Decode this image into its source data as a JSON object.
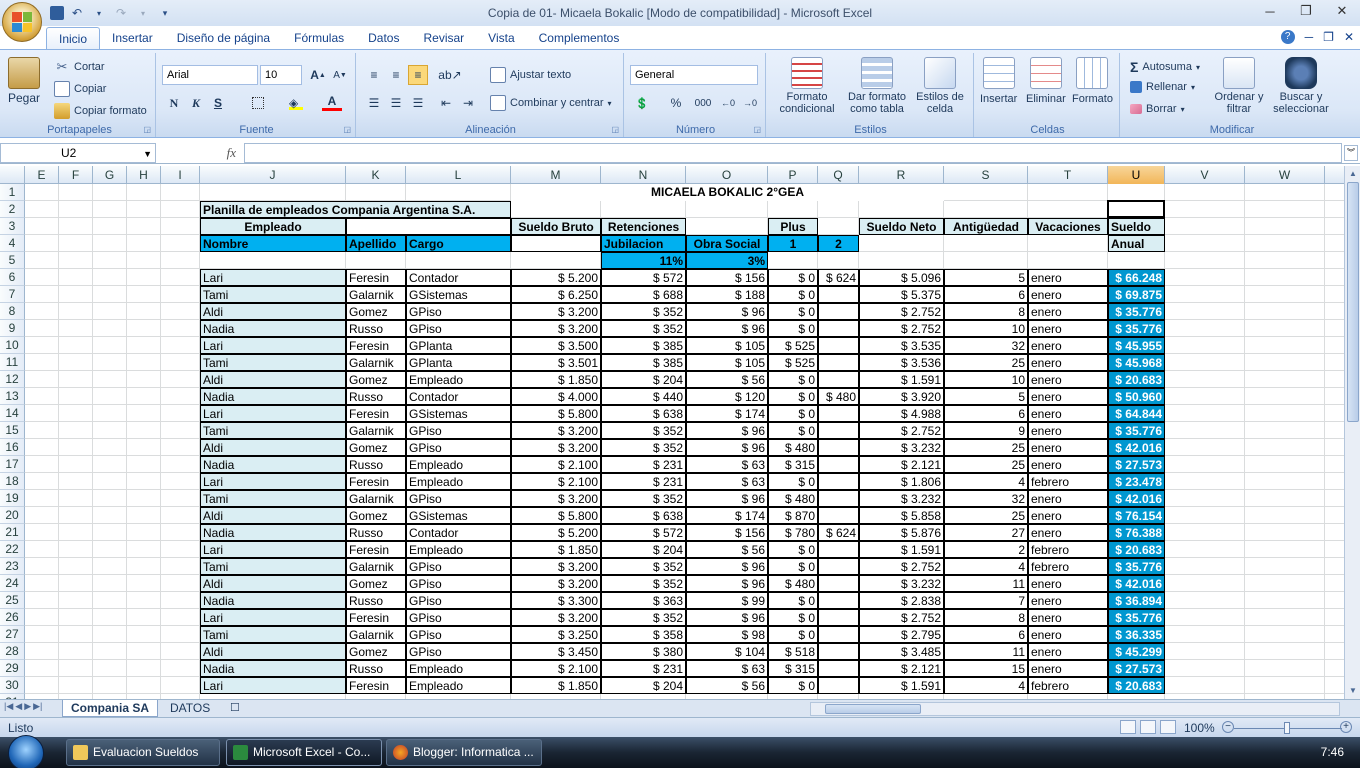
{
  "window": {
    "title": "Copia de 01- Micaela Bokalic  [Modo de compatibilidad] - Microsoft Excel",
    "minimize": "─",
    "maximize": "❐",
    "close": "✕"
  },
  "qat": {
    "save": "💾",
    "undo": "↶",
    "redo": "↷",
    "customize": "▾"
  },
  "ribbon_tabs": [
    "Inicio",
    "Insertar",
    "Diseño de página",
    "Fórmulas",
    "Datos",
    "Revisar",
    "Vista",
    "Complementos"
  ],
  "ribbon": {
    "portapapeles": {
      "pegar": "Pegar",
      "cortar": "Cortar",
      "copiar": "Copiar",
      "copiar_formato": "Copiar formato",
      "label": "Portapapeles"
    },
    "fuente": {
      "font": "Arial",
      "size": "10",
      "bold": "N",
      "italic": "K",
      "underline": "S",
      "font_color": "A",
      "label": "Fuente"
    },
    "alineacion": {
      "ajustar": "Ajustar texto",
      "combinar": "Combinar y centrar",
      "label": "Alineación"
    },
    "numero": {
      "format": "General",
      "percent": "%",
      "thousands": "000",
      "label": "Número"
    },
    "estilos": {
      "formato_condicional": "Formato condicional",
      "dar_formato": "Dar formato como tabla",
      "estilos_celda": "Estilos de celda",
      "label": "Estilos"
    },
    "celdas": {
      "insertar": "Insertar",
      "eliminar": "Eliminar",
      "formato": "Formato",
      "label": "Celdas"
    },
    "modificar": {
      "autosuma": "Autosuma",
      "rellenar": "Rellenar",
      "borrar": "Borrar",
      "ordenar": "Ordenar y filtrar",
      "buscar": "Buscar y seleccionar",
      "label": "Modificar"
    }
  },
  "formula_bar": {
    "name_box": "U2",
    "fx": "fx",
    "value": ""
  },
  "columns": [
    "E",
    "F",
    "G",
    "H",
    "I",
    "J",
    "K",
    "L",
    "M",
    "N",
    "O",
    "P",
    "Q",
    "R",
    "S",
    "T",
    "U",
    "V",
    "W"
  ],
  "selected_column": "U",
  "row_numbers": [
    "1",
    "2",
    "3",
    "4",
    "5",
    "6",
    "7",
    "8",
    "9",
    "10",
    "11",
    "12",
    "13",
    "14",
    "15",
    "16",
    "17",
    "18",
    "19",
    "20",
    "21",
    "22",
    "23",
    "24",
    "25",
    "26",
    "27",
    "28",
    "29",
    "30",
    "31"
  ],
  "sheet": {
    "banner": "MICAELA BOKALIC 2°GEA",
    "title": "Planilla de empleados Compania Argentina S.A.",
    "h_empleado": "Empleado",
    "h_sueldo_bruto": "Sueldo Bruto",
    "h_retenciones": "Retenciones",
    "h_plus": "Plus",
    "h_sueldo_neto": "Sueldo Neto",
    "h_antiguedad": "Antigüedad",
    "h_vacaciones": "Vacaciones",
    "h_sueldo": "Sueldo",
    "h_nombre": "Nombre",
    "h_apellido": "Apellido",
    "h_cargo": "Cargo",
    "h_jubilacion": "Jubilacion",
    "h_obra_social": "Obra Social",
    "h_plus1": "1",
    "h_plus2": "2",
    "h_anual": "Anual",
    "pct_jub": "11%",
    "pct_os": "3%",
    "rows": [
      [
        "Lari",
        "Feresin",
        "Contador",
        "$ 5.200",
        "$ 572",
        "$ 156",
        "$ 0",
        "$ 624",
        "$ 5.096",
        "5",
        "enero",
        "$ 66.248"
      ],
      [
        "Tami",
        "Galarnik",
        "GSistemas",
        "$ 6.250",
        "$ 688",
        "$ 188",
        "$ 0",
        "",
        "$ 5.375",
        "6",
        "enero",
        "$ 69.875"
      ],
      [
        "Aldi",
        "Gomez",
        "GPiso",
        "$ 3.200",
        "$ 352",
        "$ 96",
        "$ 0",
        "",
        "$ 2.752",
        "8",
        "enero",
        "$ 35.776"
      ],
      [
        "Nadia",
        "Russo",
        "GPiso",
        "$ 3.200",
        "$ 352",
        "$ 96",
        "$ 0",
        "",
        "$ 2.752",
        "10",
        "enero",
        "$ 35.776"
      ],
      [
        "Lari",
        "Feresin",
        "GPlanta",
        "$ 3.500",
        "$ 385",
        "$ 105",
        "$ 525",
        "",
        "$ 3.535",
        "32",
        "enero",
        "$ 45.955"
      ],
      [
        "Tami",
        "Galarnik",
        "GPlanta",
        "$ 3.501",
        "$ 385",
        "$ 105",
        "$ 525",
        "",
        "$ 3.536",
        "25",
        "enero",
        "$ 45.968"
      ],
      [
        "Aldi",
        "Gomez",
        "Empleado",
        "$ 1.850",
        "$ 204",
        "$ 56",
        "$ 0",
        "",
        "$ 1.591",
        "10",
        "enero",
        "$ 20.683"
      ],
      [
        "Nadia",
        "Russo",
        "Contador",
        "$ 4.000",
        "$ 440",
        "$ 120",
        "$ 0",
        "$ 480",
        "$ 3.920",
        "5",
        "enero",
        "$ 50.960"
      ],
      [
        "Lari",
        "Feresin",
        "GSistemas",
        "$ 5.800",
        "$ 638",
        "$ 174",
        "$ 0",
        "",
        "$ 4.988",
        "6",
        "enero",
        "$ 64.844"
      ],
      [
        "Tami",
        "Galarnik",
        "GPiso",
        "$ 3.200",
        "$ 352",
        "$ 96",
        "$ 0",
        "",
        "$ 2.752",
        "9",
        "enero",
        "$ 35.776"
      ],
      [
        "Aldi",
        "Gomez",
        "GPiso",
        "$ 3.200",
        "$ 352",
        "$ 96",
        "$ 480",
        "",
        "$ 3.232",
        "25",
        "enero",
        "$ 42.016"
      ],
      [
        "Nadia",
        "Russo",
        "Empleado",
        "$ 2.100",
        "$ 231",
        "$ 63",
        "$ 315",
        "",
        "$ 2.121",
        "25",
        "enero",
        "$ 27.573"
      ],
      [
        "Lari",
        "Feresin",
        "Empleado",
        "$ 2.100",
        "$ 231",
        "$ 63",
        "$ 0",
        "",
        "$ 1.806",
        "4",
        "febrero",
        "$ 23.478"
      ],
      [
        "Tami",
        "Galarnik",
        "GPiso",
        "$ 3.200",
        "$ 352",
        "$ 96",
        "$ 480",
        "",
        "$ 3.232",
        "32",
        "enero",
        "$ 42.016"
      ],
      [
        "Aldi",
        "Gomez",
        "GSistemas",
        "$ 5.800",
        "$ 638",
        "$ 174",
        "$ 870",
        "",
        "$ 5.858",
        "25",
        "enero",
        "$ 76.154"
      ],
      [
        "Nadia",
        "Russo",
        "Contador",
        "$ 5.200",
        "$ 572",
        "$ 156",
        "$ 780",
        "$ 624",
        "$ 5.876",
        "27",
        "enero",
        "$ 76.388"
      ],
      [
        "Lari",
        "Feresin",
        "Empleado",
        "$ 1.850",
        "$ 204",
        "$ 56",
        "$ 0",
        "",
        "$ 1.591",
        "2",
        "febrero",
        "$ 20.683"
      ],
      [
        "Tami",
        "Galarnik",
        "GPiso",
        "$ 3.200",
        "$ 352",
        "$ 96",
        "$ 0",
        "",
        "$ 2.752",
        "4",
        "febrero",
        "$ 35.776"
      ],
      [
        "Aldi",
        "Gomez",
        "GPiso",
        "$ 3.200",
        "$ 352",
        "$ 96",
        "$ 480",
        "",
        "$ 3.232",
        "11",
        "enero",
        "$ 42.016"
      ],
      [
        "Nadia",
        "Russo",
        "GPiso",
        "$ 3.300",
        "$ 363",
        "$ 99",
        "$ 0",
        "",
        "$ 2.838",
        "7",
        "enero",
        "$ 36.894"
      ],
      [
        "Lari",
        "Feresin",
        "GPiso",
        "$ 3.200",
        "$ 352",
        "$ 96",
        "$ 0",
        "",
        "$ 2.752",
        "8",
        "enero",
        "$ 35.776"
      ],
      [
        "Tami",
        "Galarnik",
        "GPiso",
        "$ 3.250",
        "$ 358",
        "$ 98",
        "$ 0",
        "",
        "$ 2.795",
        "6",
        "enero",
        "$ 36.335"
      ],
      [
        "Aldi",
        "Gomez",
        "GPiso",
        "$ 3.450",
        "$ 380",
        "$ 104",
        "$ 518",
        "",
        "$ 3.485",
        "11",
        "enero",
        "$ 45.299"
      ],
      [
        "Nadia",
        "Russo",
        "Empleado",
        "$ 2.100",
        "$ 231",
        "$ 63",
        "$ 315",
        "",
        "$ 2.121",
        "15",
        "enero",
        "$ 27.573"
      ],
      [
        "Lari",
        "Feresin",
        "Empleado",
        "$ 1.850",
        "$ 204",
        "$ 56",
        "$ 0",
        "",
        "$ 1.591",
        "4",
        "febrero",
        "$ 20.683"
      ]
    ]
  },
  "sheet_tabs": [
    "Compania SA",
    "DATOS"
  ],
  "status": {
    "ready": "Listo",
    "zoom": "100%"
  },
  "taskbar": {
    "items": [
      "Evaluacion Sueldos",
      "Microsoft Excel - Co...",
      "Blogger: Informatica ..."
    ],
    "clock": "7:46"
  },
  "colors": {
    "header_fill": "#00b0f0",
    "title_fill": "#daeef3",
    "accent_blue": "#0097d0"
  }
}
